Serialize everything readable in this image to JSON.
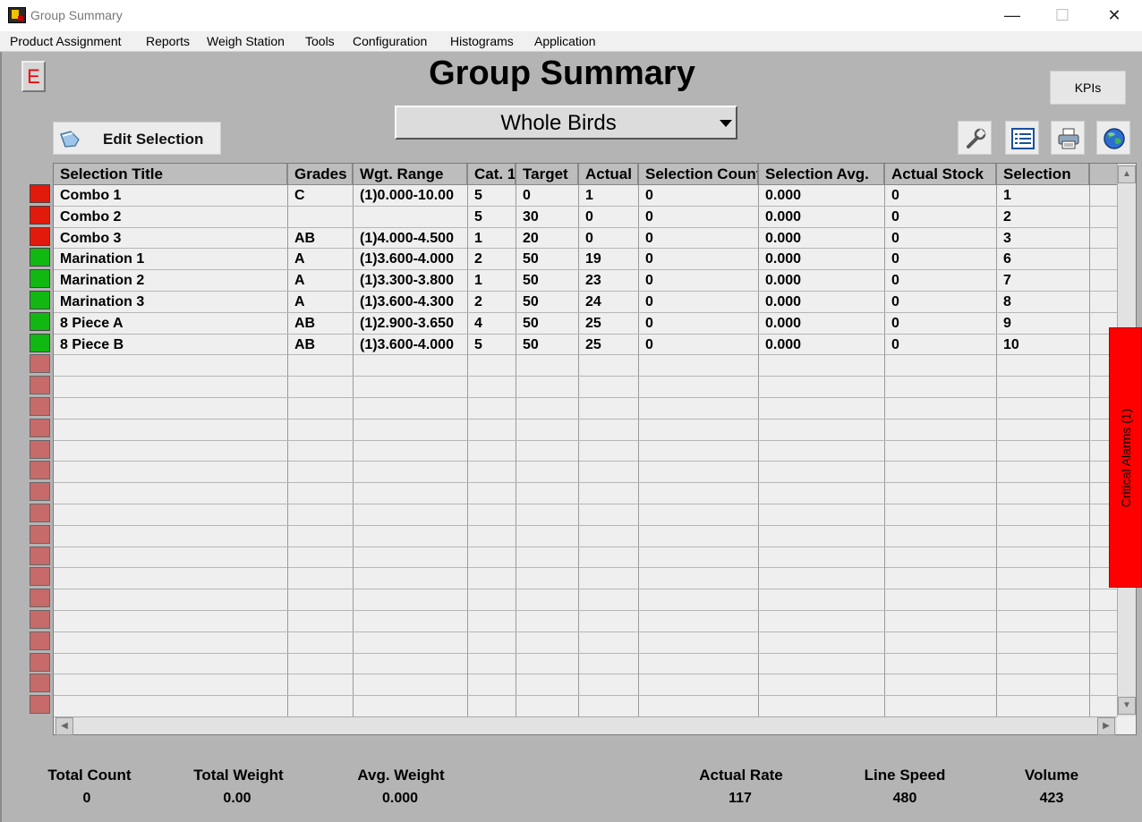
{
  "window": {
    "title": "Group Summary",
    "minimize": "—",
    "maximize": "☐",
    "close": "✕"
  },
  "menu": [
    "Product Assignment",
    "Reports",
    "Weigh Station",
    "Tools",
    "Configuration",
    "Histograms",
    "Application"
  ],
  "e_button": "E",
  "page_title": "Group Summary",
  "kpi_button": "KPIs",
  "edit_selection": "Edit Selection",
  "dropdown": {
    "value": "Whole Birds"
  },
  "toolbar_icons": [
    "wrench-icon",
    "list-icon",
    "printer-icon",
    "globe-icon"
  ],
  "table": {
    "headers": [
      "Selection Title",
      "Grades",
      "Wgt. Range",
      "Cat. 1",
      "Target",
      "Actual",
      "Selection Count",
      "Selection Avg.",
      "Actual Stock",
      "Selection"
    ],
    "rows": [
      [
        "Combo 1",
        "C",
        "(1)0.000-10.00",
        "5",
        "0",
        "1",
        "0",
        "0.000",
        "0",
        "1"
      ],
      [
        "Combo 2",
        "",
        "",
        "5",
        "30",
        "0",
        "0",
        "0.000",
        "0",
        "2"
      ],
      [
        "Combo 3",
        "AB",
        "(1)4.000-4.500",
        "1",
        "20",
        "0",
        "0",
        "0.000",
        "0",
        "3"
      ],
      [
        "Marination 1",
        "A",
        "(1)3.600-4.000",
        "2",
        "50",
        "19",
        "0",
        "0.000",
        "0",
        "6"
      ],
      [
        "Marination 2",
        "A",
        "(1)3.300-3.800",
        "1",
        "50",
        "23",
        "0",
        "0.000",
        "0",
        "7"
      ],
      [
        "Marination 3",
        "A",
        "(1)3.600-4.300",
        "2",
        "50",
        "24",
        "0",
        "0.000",
        "0",
        "8"
      ],
      [
        "8 Piece A",
        "AB",
        "(1)2.900-3.650",
        "4",
        "50",
        "25",
        "0",
        "0.000",
        "0",
        "9"
      ],
      [
        "8 Piece B",
        "AB",
        "(1)3.600-4.000",
        "5",
        "50",
        "25",
        "0",
        "0.000",
        "0",
        "10"
      ]
    ],
    "row_status": [
      "red",
      "red",
      "red",
      "green",
      "green",
      "green",
      "green",
      "green"
    ],
    "total_rows": 25
  },
  "alarm_tab": "Critical Alarms (1)",
  "footer": [
    {
      "label": "Total Count",
      "value": "0"
    },
    {
      "label": "Total Weight",
      "value": "0.00"
    },
    {
      "label": "Avg. Weight",
      "value": "0.000"
    },
    {
      "label": "Actual Rate",
      "value": "117"
    },
    {
      "label": "Line Speed",
      "value": "480"
    },
    {
      "label": "Volume",
      "value": "423"
    }
  ],
  "colors": {
    "status_red": "#e21a0c",
    "status_green": "#12b812",
    "status_off": "#c66a6a",
    "alarm": "#ff0000"
  }
}
